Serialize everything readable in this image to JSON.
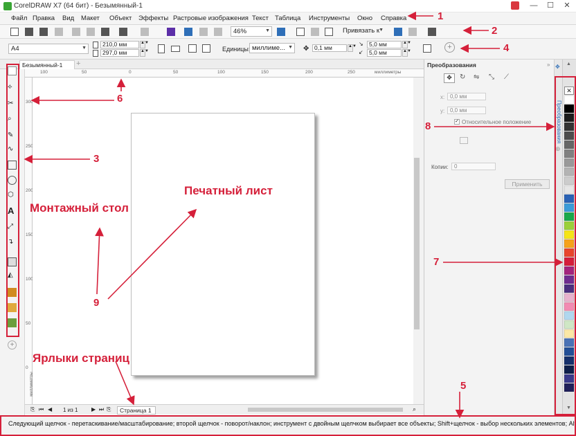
{
  "window": {
    "title": "CorelDRAW X7 (64 бит) - Безымянный-1",
    "minimize": "—",
    "maximize": "☐",
    "close": "✕"
  },
  "menu": [
    "Файл",
    "Правка",
    "Вид",
    "Макет",
    "Объект",
    "Эффекты",
    "Растровые изображения",
    "Текст",
    "Таблица",
    "Инструменты",
    "Окно",
    "Справка"
  ],
  "toolbar": {
    "zoom": "46%",
    "snap_label": "Привязать к"
  },
  "propbar": {
    "paper_size": "A4",
    "width": "210,0 мм",
    "height": "297,0 мм",
    "units_label": "Единицы:",
    "units_value": "миллиме...",
    "nudge": "0,1 мм",
    "dup_x": "5,0 мм",
    "dup_y": "5,0 мм"
  },
  "document": {
    "tab_name": "Безымянный-1",
    "ruler_unit": "миллиметры",
    "ruler_h_ticks": [
      "100",
      "50",
      "0",
      "50",
      "100",
      "150",
      "200",
      "250"
    ],
    "ruler_v_ticks": [
      "300",
      "250",
      "200",
      "150",
      "100",
      "50",
      "0"
    ],
    "vruler_unit": "миллиметры"
  },
  "pagenav": {
    "counter": "1 из 1",
    "page_tab": "Страница 1"
  },
  "docker": {
    "title": "Преобразования",
    "x_label": "x:",
    "x_value": "0,0 мм",
    "y_label": "y:",
    "y_value": "0,0 мм",
    "relative_label": "Относительное положение",
    "copies_label": "Копии:",
    "copies_value": "0",
    "apply_label": "Применить",
    "side_tab": "Преобразования"
  },
  "palette": [
    "#ffffff",
    "#000000",
    "#1c1c1c",
    "#333333",
    "#4d4d4d",
    "#666666",
    "#808080",
    "#999999",
    "#b3b3b3",
    "#cccccc",
    "#e6e6e6",
    "#2a62b5",
    "#3b9bd8",
    "#1aa84b",
    "#9bd03a",
    "#f5e418",
    "#f6a21b",
    "#e8452c",
    "#d41e3b",
    "#a3247d",
    "#6f2c8f",
    "#4b2f7e",
    "#e7b2cd",
    "#f28bb2",
    "#b0d7ef",
    "#cfe7c5",
    "#fbe8a6",
    "#4a72b5",
    "#234f96",
    "#16306b",
    "#0e1f4a",
    "#3a3a8a",
    "#20205a"
  ],
  "status": {
    "text": "Следующий щелчок - перетаскивание/масштабирование; второй щелчок - поворот/наклон; инструмент с двойным щелчком выбирает все объекты; Shift+щелчок - выбор нескольких элементов; Alt"
  },
  "annotations": {
    "n1": "1",
    "n2": "2",
    "n3": "3",
    "n4": "4",
    "n5": "5",
    "n6": "6",
    "n7": "7",
    "n8": "8",
    "n9": "9",
    "print_sheet": "Печатный лист",
    "desktop": "Монтажный стол",
    "page_labels": "Ярлыки страниц"
  },
  "colors": {
    "annotation": "#d5203a",
    "app_icon": "#3aa635"
  }
}
